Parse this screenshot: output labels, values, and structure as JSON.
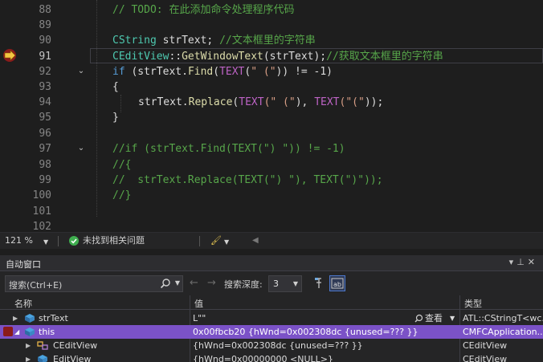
{
  "editor": {
    "lines": [
      {
        "num": "88",
        "text": "// TODO: 在此添加命令处理程序代码"
      },
      {
        "num": "89",
        "text": ""
      },
      {
        "num": "90",
        "type": "CString",
        "rest": " strText; ",
        "comment": "//文本框里的字符串"
      },
      {
        "num": "91",
        "class": "CEditView",
        "sep": "::",
        "fn": "GetWindowText",
        "args": "(strText);",
        "comment": "//获取文本框里的字符串"
      },
      {
        "num": "92",
        "kw": "if",
        "p1": " (strText.",
        "fn": "Find",
        "p2": "(",
        "mac": "TEXT",
        "p3": "(",
        "s": "\" (\"",
        "p4": ")) != -1)"
      },
      {
        "num": "93",
        "text": "{"
      },
      {
        "num": "94",
        "p0": "strText.",
        "fn": "Replace",
        "p1": "(",
        "mac1": "TEXT",
        "s1": "(\" (\"",
        "p2": "), ",
        "mac2": "TEXT",
        "s2": "(\"(\"",
        "p3": "));"
      },
      {
        "num": "95",
        "text": "}"
      },
      {
        "num": "96",
        "text": ""
      },
      {
        "num": "97",
        "text": "//if (strText.Find(TEXT(\") \")) != -1)"
      },
      {
        "num": "98",
        "text": "//{"
      },
      {
        "num": "99",
        "text": "//  strText.Replace(TEXT(\") \"), TEXT(\")\"));"
      },
      {
        "num": "100",
        "text": "//}"
      },
      {
        "num": "101",
        "text": ""
      },
      {
        "num": "102",
        "text": ""
      }
    ]
  },
  "status_bar": {
    "zoom": "121 %",
    "issues": "未找到相关问题"
  },
  "auto_window": {
    "title": "自动窗口",
    "search_placeholder": "搜索(Ctrl+E)",
    "depth_label": "搜索深度:",
    "depth_value": "3",
    "columns": {
      "name": "名称",
      "value": "值",
      "type": "类型"
    },
    "rows": [
      {
        "name": "strText",
        "value": "L\"\"",
        "view": "查看",
        "type": "ATL::CStringT<wc..."
      },
      {
        "name": "this",
        "value": "0x00fbcb20 {hWnd=0x002308dc {unused=??? }}",
        "type": "CMFCApplication..."
      },
      {
        "name": "CEditView",
        "value": "{hWnd=0x002308dc {unused=??? }}",
        "type": "CEditView"
      },
      {
        "name": "EditView",
        "value": "{hWnd=0x00000000 <NULL>}",
        "type": "CEditView"
      }
    ]
  },
  "colors": {
    "selection": "#7b52c7",
    "comment": "#57a64a",
    "keyword": "#569cd6",
    "type": "#4ec9b0"
  }
}
